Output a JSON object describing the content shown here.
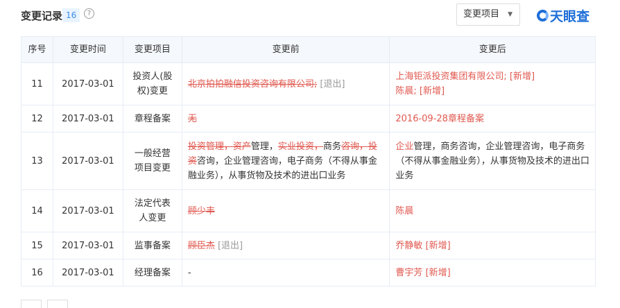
{
  "header": {
    "title": "变更记录",
    "count": "16",
    "help": "?",
    "filter_label": "变更项目",
    "filter_caret": "▼",
    "logo": "天眼查"
  },
  "columns": [
    "序号",
    "变更时间",
    "变更项目",
    "变更前",
    "变更后"
  ],
  "rows": [
    {
      "no": "11",
      "date": "2017-03-01",
      "item": "投资人(股权)变更",
      "before": [
        {
          "t": "北京拍拍融信投资咨询有限公司;",
          "s": "strike"
        },
        {
          "t": " [退出]",
          "s": "gray"
        }
      ],
      "after": [
        {
          "t": "上海钜派投资集团有限公司; [新增]",
          "s": "red"
        },
        {
          "t": "\n"
        },
        {
          "t": "陈晨; [新增]",
          "s": "red"
        }
      ]
    },
    {
      "no": "12",
      "date": "2017-03-01",
      "item": "章程备案",
      "before": [
        {
          "t": "无",
          "s": "strike"
        }
      ],
      "after": [
        {
          "t": "2016-09-28章程备案",
          "s": "red"
        }
      ]
    },
    {
      "no": "13",
      "date": "2017-03-01",
      "item": "一般经营项目变更",
      "before": [
        {
          "t": "投资管理，资产",
          "s": "strike"
        },
        {
          "t": "管理，",
          "s": ""
        },
        {
          "t": "实业投资，",
          "s": "strike"
        },
        {
          "t": "商务",
          "s": ""
        },
        {
          "t": "咨询，投资",
          "s": "strike"
        },
        {
          "t": "咨询，企业管理咨询，电子商务（不得从事金融业务），从事货物及技术的进出口业务",
          "s": ""
        }
      ],
      "after": [
        {
          "t": "企业",
          "s": "red"
        },
        {
          "t": "管理，商务咨询，企业管理咨询，电子商务（不得从事金融业务），从事货物及技术的进出口业务",
          "s": ""
        }
      ]
    },
    {
      "no": "14",
      "date": "2017-03-01",
      "item": "法定代表人变更",
      "before": [
        {
          "t": "顾少丰",
          "s": "strike"
        }
      ],
      "after": [
        {
          "t": "陈晨",
          "s": "red"
        }
      ]
    },
    {
      "no": "15",
      "date": "2017-03-01",
      "item": "监事备案",
      "before": [
        {
          "t": "顾臣杰",
          "s": "strike"
        },
        {
          "t": " [退出]",
          "s": "gray"
        }
      ],
      "after": [
        {
          "t": "乔静敏 [新增]",
          "s": "red"
        }
      ]
    },
    {
      "no": "16",
      "date": "2017-03-01",
      "item": "经理备案",
      "before": [
        {
          "t": "-",
          "s": ""
        }
      ],
      "after": [
        {
          "t": "曹宇芳 [新增]",
          "s": "red"
        }
      ]
    }
  ]
}
